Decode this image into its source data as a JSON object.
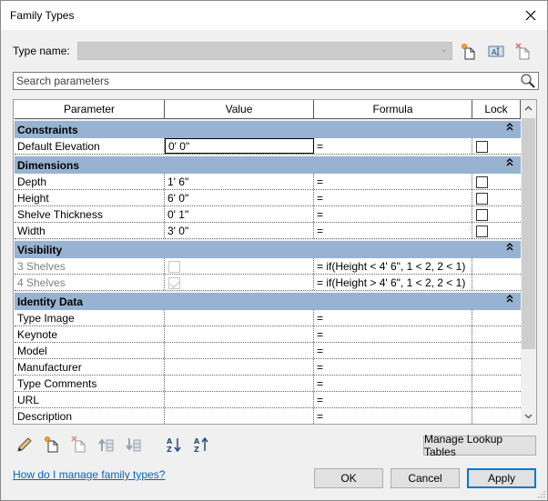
{
  "window": {
    "title": "Family Types"
  },
  "type_name": {
    "label": "Type name:",
    "value": "",
    "toolbar_icons": [
      "new-type-icon",
      "rename-type-icon",
      "delete-type-icon"
    ]
  },
  "search": {
    "placeholder": "Search parameters"
  },
  "table": {
    "columns": [
      "Parameter",
      "Value",
      "Formula",
      "Lock"
    ],
    "groups": [
      {
        "name": "Constraints",
        "rows": [
          {
            "parameter": "Default Elevation",
            "value": "0'  0\"",
            "formula": "=",
            "lock": false,
            "active": true
          }
        ]
      },
      {
        "name": "Dimensions",
        "rows": [
          {
            "parameter": "Depth",
            "value": "1'  6\"",
            "formula": "=",
            "lock": false
          },
          {
            "parameter": "Height",
            "value": "6'  0\"",
            "formula": "=",
            "lock": false
          },
          {
            "parameter": "Shelve Thickness",
            "value": "0'  1\"",
            "formula": "=",
            "lock": false
          },
          {
            "parameter": "Width",
            "value": "3'  0\"",
            "formula": "=",
            "lock": false
          }
        ]
      },
      {
        "name": "Visibility",
        "rows": [
          {
            "parameter": "3 Shelves",
            "value_checkbox": false,
            "formula": "= if(Height < 4'  6\", 1 < 2, 2 < 1)",
            "disabled": true
          },
          {
            "parameter": "4 Shelves",
            "value_checkbox": true,
            "formula": "= if(Height > 4'  6\", 1 < 2, 2 < 1)",
            "disabled": true
          }
        ]
      },
      {
        "name": "Identity Data",
        "rows": [
          {
            "parameter": "Type Image",
            "value": "",
            "formula": "="
          },
          {
            "parameter": "Keynote",
            "value": "",
            "formula": "="
          },
          {
            "parameter": "Model",
            "value": "",
            "formula": "="
          },
          {
            "parameter": "Manufacturer",
            "value": "",
            "formula": "="
          },
          {
            "parameter": "Type Comments",
            "value": "",
            "formula": "="
          },
          {
            "parameter": "URL",
            "value": "",
            "formula": "="
          },
          {
            "parameter": "Description",
            "value": "",
            "formula": "="
          }
        ]
      }
    ]
  },
  "bottom_toolbar": {
    "icons": [
      "edit-parameter-icon",
      "new-parameter-icon",
      "delete-parameter-icon",
      "move-up-icon",
      "move-down-icon",
      "sort-ascending-icon",
      "sort-descending-icon"
    ]
  },
  "buttons": {
    "manage_lookup": "Manage Lookup Tables",
    "ok": "OK",
    "cancel": "Cancel",
    "apply": "Apply"
  },
  "help_link": "How do I manage family types?"
}
